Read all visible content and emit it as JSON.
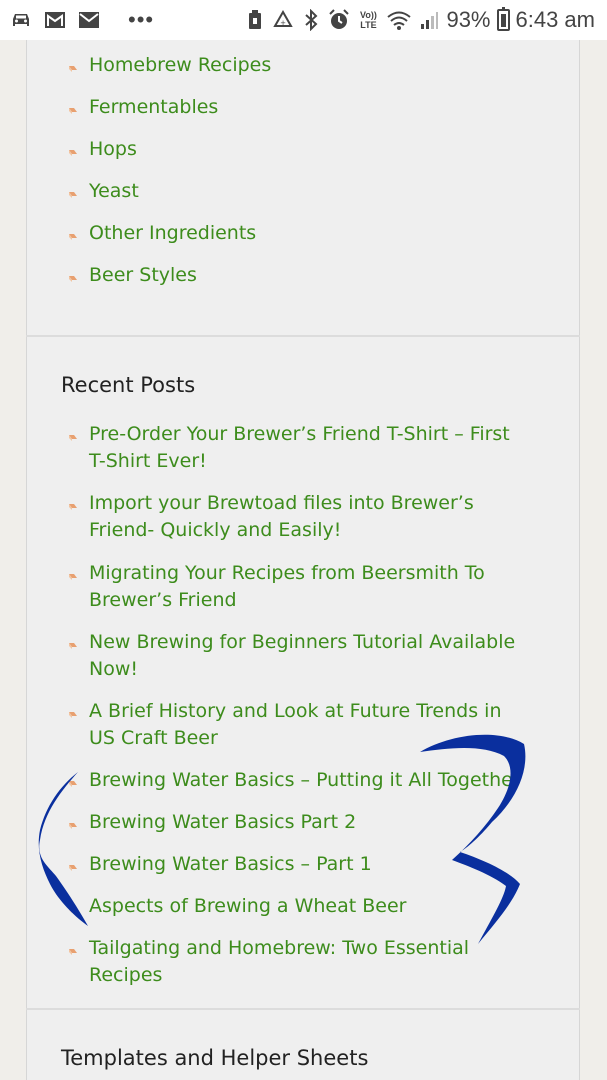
{
  "status_bar": {
    "icons_left": [
      "car-icon",
      "gmail-icon",
      "mail-icon"
    ],
    "overflow": "•••",
    "icons_right": [
      "nfc-icon",
      "recycle-icon",
      "bluetooth-icon",
      "alarm-icon",
      "volte-icon",
      "wifi-icon",
      "signal-icon"
    ],
    "volte_top": "Vo))",
    "volte_bottom": "LTE",
    "battery_percent": "93%",
    "time": "6:43 am"
  },
  "categories": {
    "items": [
      {
        "label": "Homebrew Recipes"
      },
      {
        "label": "Fermentables"
      },
      {
        "label": "Hops"
      },
      {
        "label": "Yeast"
      },
      {
        "label": "Other Ingredients"
      },
      {
        "label": "Beer Styles"
      }
    ]
  },
  "recent_posts": {
    "title": "Recent Posts",
    "items": [
      {
        "label": "Pre-Order Your Brewer’s Friend T-Shirt – First T-Shirt Ever!"
      },
      {
        "label": "Import your Brewtoad files into Brewer’s Friend- Quickly and Easily!"
      },
      {
        "label": "Migrating Your Recipes from Beersmith To Brewer’s Friend"
      },
      {
        "label": "New Brewing for Beginners Tutorial Available Now!"
      },
      {
        "label": "A Brief History and Look at Future Trends in US Craft Beer"
      },
      {
        "label": "Brewing Water Basics – Putting it All Together"
      },
      {
        "label": "Brewing Water Basics Part 2"
      },
      {
        "label": "Brewing Water Basics – Part 1"
      },
      {
        "label": "Aspects of Brewing a Wheat Beer"
      },
      {
        "label": "Tailgating and Homebrew: Two Essential Recipes"
      }
    ]
  },
  "templates": {
    "title": "Templates and Helper Sheets"
  },
  "colors": {
    "link": "#3d8c1c",
    "bullet": "#e8a070",
    "scribble": "#0a2f9e"
  }
}
